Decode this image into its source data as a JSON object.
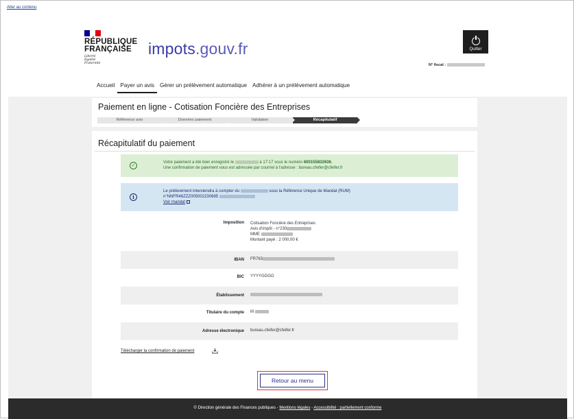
{
  "skip_link": "Aller au contenu",
  "header": {
    "republic_line1": "RÉPUBLIQUE",
    "republic_line2": "FRANÇAISE",
    "devise_1": "Liberté",
    "devise_2": "Égalité",
    "devise_3": "Fraternité",
    "brand_main": "impots",
    "brand_suffix": ".gouv.fr",
    "quit_label": "Quitter",
    "fiscal_label": "N° fiscal :",
    "colors": {
      "flag_blue": "#000091",
      "flag_white": "#ffffff",
      "flag_red": "#e1000f",
      "brand": "#3b3ba8"
    }
  },
  "nav": {
    "items": [
      {
        "label": "Accueil",
        "active": false
      },
      {
        "label": "Payer un avis",
        "active": true
      },
      {
        "label": "Gérer un prélèvement automatique",
        "active": false
      },
      {
        "label": "Adhérer à un prélèvement automatique",
        "active": false
      }
    ]
  },
  "payment": {
    "title": "Paiement en ligne - Cotisation Foncière des Entreprises",
    "steps": [
      "Référence avis",
      "Données paiement",
      "Validation",
      "Récapitulatif"
    ],
    "current_step": 3
  },
  "summary": {
    "title": "Récapitulatif du paiement",
    "success_line1_a": "Votre paiement a été bien enregistré le",
    "success_line1_b": "à 17:17 sous le numéro",
    "payment_number": "600155832636.",
    "success_line2": "Une confirmation de paiement vous est adressée par courriel à l'adresse : bureau.cfeifer@cfeifer.fr",
    "info_line1_a": "Le prélèvement interviendra à compter du",
    "info_line1_b": "sous la Référence Unique de Mandat (RUM)",
    "info_rum": "n°NNFR46ZZZ005002230685",
    "info_link": "Voir mandat"
  },
  "details": {
    "imposition_label": "Imposition",
    "imposition_line1": "Cotisation Foncière des Entreprises",
    "imposition_line2": "Avis d'impôt - n°230",
    "imposition_line3": "MME",
    "imposition_line4": "Montant payé : 2 000,00 €",
    "iban_label": "IBAN",
    "iban_value": "FR763",
    "bic_label": "BIC",
    "bic_value": "YYYYGGGG",
    "etab_label": "Établissement",
    "titulaire_label": "Titulaire du compte",
    "titulaire_value": "M",
    "email_label": "Adresse électronique",
    "email_value": "bureau.cfeifer@cfeifer.fr"
  },
  "download_label": "Télécharger la confirmation de paiement",
  "back_button": "Retour au menu",
  "footer": {
    "copyright": "© Direction générale des Finances publiques -",
    "legal": "Mentions légales",
    "sep": "-",
    "accessibility": "Accessibilité : partiellement conforme"
  }
}
